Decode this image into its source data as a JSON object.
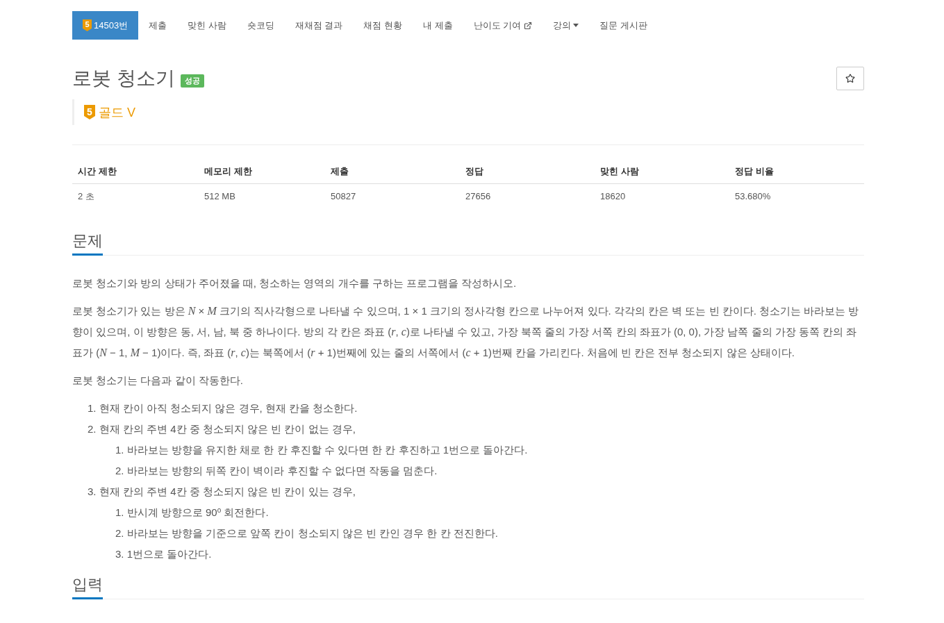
{
  "nav": {
    "tabs": [
      {
        "kind": "badge",
        "badge": "5",
        "label": "14503번",
        "selected": true
      },
      {
        "kind": "plain",
        "label": "제출",
        "selected": false
      },
      {
        "kind": "plain",
        "label": "맞힌 사람",
        "selected": false
      },
      {
        "kind": "plain",
        "label": "숏코딩",
        "selected": false
      },
      {
        "kind": "plain",
        "label": "재채점 결과",
        "selected": false
      },
      {
        "kind": "plain",
        "label": "채점 현황",
        "selected": false
      },
      {
        "kind": "plain",
        "label": "내 제출",
        "selected": false
      },
      {
        "kind": "external",
        "label": "난이도 기여",
        "selected": false
      },
      {
        "kind": "dropdown",
        "label": "강의",
        "selected": false
      },
      {
        "kind": "plain",
        "label": "질문 게시판",
        "selected": false
      }
    ]
  },
  "problem": {
    "title": "로봇 청소기",
    "result_badge": "성공",
    "tier": {
      "digit": "5",
      "label": "골드 V"
    }
  },
  "stats_table": {
    "columns": [
      "시간 제한",
      "메모리 제한",
      "제출",
      "정답",
      "맞힌 사람",
      "정답 비율"
    ],
    "rows": [
      [
        "2 초",
        "512 MB",
        "50827",
        "27656",
        "18620",
        "53.680%"
      ]
    ]
  },
  "sections": [
    {
      "heading": "문제",
      "blocks": [
        {
          "kind": "paragraph",
          "text": "로봇 청소기와 방의 상태가 주어졌을 때, 청소하는 영역의 개수를 구하는 프로그램을 작성하시오."
        },
        {
          "kind": "paragraph",
          "text": "로봇 청소기가 있는 방은 *N* × *M* 크기의 직사각형으로 나타낼 수 있으며, 1 × 1 크기의 정사각형 칸으로 나누어져 있다. 각각의 칸은 벽 또는 빈 칸이다. 청소기는 바라보는 방향이 있으며, 이 방향은 동, 서, 남, 북 중 하나이다. 방의 각 칸은 좌표 (*r*, *c*)로 나타낼 수 있고, 가장 북쪽 줄의 가장 서쪽 칸의 좌표가 (0, 0), 가장 남쪽 줄의 가장 동쪽 칸의 좌표가 (*N* − 1, *M* − 1)이다. 즉, 좌표 (*r*, *c*)는 북쪽에서 (*r* + 1)번째에 있는 줄의 서쪽에서 (*c* + 1)번째 칸을 가리킨다. 처음에 빈 칸은 전부 청소되지 않은 상태이다."
        },
        {
          "kind": "paragraph",
          "text": "로봇 청소기는 다음과 같이 작동한다."
        },
        {
          "kind": "list",
          "items": [
            {
              "number": "1.",
              "text": "현재 칸이 아직 청소되지 않은 경우, 현재 칸을 청소한다."
            },
            {
              "number": "2.",
              "text": "현재 칸의 주변 4칸 중 청소되지 않은 빈 칸이 없는 경우,",
              "children": [
                {
                  "number": "1.",
                  "text": "바라보는 방향을 유지한 채로 한 칸 후진할 수 있다면 한 칸 후진하고 1번으로 돌아간다."
                },
                {
                  "number": "2.",
                  "text": "바라보는 방향의 뒤쪽 칸이 벽이라 후진할 수 없다면 작동을 멈춘다."
                }
              ]
            },
            {
              "number": "3.",
              "text": "현재 칸의 주변 4칸 중 청소되지 않은 빈 칸이 있는 경우,",
              "children": [
                {
                  "number": "1.",
                  "text": "반시계 방향으로 90$^{o}$ 회전한다."
                },
                {
                  "number": "2.",
                  "text": "바라보는 방향을 기준으로 앞쪽 칸이 청소되지 않은 빈 칸인 경우 한 칸 전진한다."
                },
                {
                  "number": "3.",
                  "text": "1번으로 돌아간다."
                }
              ]
            }
          ]
        }
      ]
    },
    {
      "heading": "입력"
    }
  ]
}
